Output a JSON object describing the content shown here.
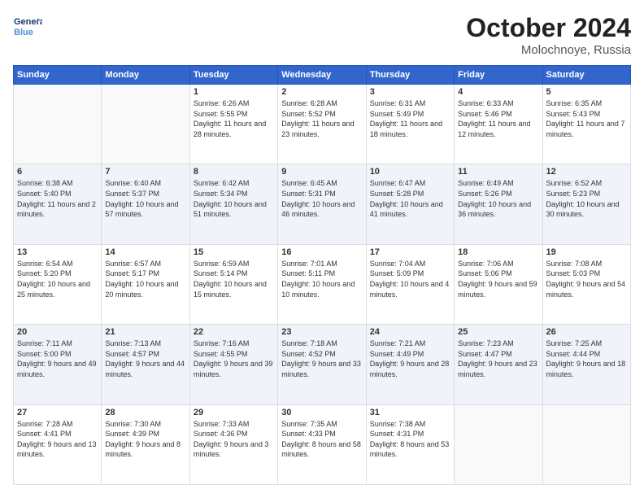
{
  "header": {
    "logo_line1": "General",
    "logo_line2": "Blue",
    "month": "October 2024",
    "location": "Molochnoye, Russia"
  },
  "weekdays": [
    "Sunday",
    "Monday",
    "Tuesday",
    "Wednesday",
    "Thursday",
    "Friday",
    "Saturday"
  ],
  "weeks": [
    [
      {
        "day": "",
        "info": ""
      },
      {
        "day": "",
        "info": ""
      },
      {
        "day": "1",
        "info": "Sunrise: 6:26 AM\nSunset: 5:55 PM\nDaylight: 11 hours and 28 minutes."
      },
      {
        "day": "2",
        "info": "Sunrise: 6:28 AM\nSunset: 5:52 PM\nDaylight: 11 hours and 23 minutes."
      },
      {
        "day": "3",
        "info": "Sunrise: 6:31 AM\nSunset: 5:49 PM\nDaylight: 11 hours and 18 minutes."
      },
      {
        "day": "4",
        "info": "Sunrise: 6:33 AM\nSunset: 5:46 PM\nDaylight: 11 hours and 12 minutes."
      },
      {
        "day": "5",
        "info": "Sunrise: 6:35 AM\nSunset: 5:43 PM\nDaylight: 11 hours and 7 minutes."
      }
    ],
    [
      {
        "day": "6",
        "info": "Sunrise: 6:38 AM\nSunset: 5:40 PM\nDaylight: 11 hours and 2 minutes."
      },
      {
        "day": "7",
        "info": "Sunrise: 6:40 AM\nSunset: 5:37 PM\nDaylight: 10 hours and 57 minutes."
      },
      {
        "day": "8",
        "info": "Sunrise: 6:42 AM\nSunset: 5:34 PM\nDaylight: 10 hours and 51 minutes."
      },
      {
        "day": "9",
        "info": "Sunrise: 6:45 AM\nSunset: 5:31 PM\nDaylight: 10 hours and 46 minutes."
      },
      {
        "day": "10",
        "info": "Sunrise: 6:47 AM\nSunset: 5:28 PM\nDaylight: 10 hours and 41 minutes."
      },
      {
        "day": "11",
        "info": "Sunrise: 6:49 AM\nSunset: 5:26 PM\nDaylight: 10 hours and 36 minutes."
      },
      {
        "day": "12",
        "info": "Sunrise: 6:52 AM\nSunset: 5:23 PM\nDaylight: 10 hours and 30 minutes."
      }
    ],
    [
      {
        "day": "13",
        "info": "Sunrise: 6:54 AM\nSunset: 5:20 PM\nDaylight: 10 hours and 25 minutes."
      },
      {
        "day": "14",
        "info": "Sunrise: 6:57 AM\nSunset: 5:17 PM\nDaylight: 10 hours and 20 minutes."
      },
      {
        "day": "15",
        "info": "Sunrise: 6:59 AM\nSunset: 5:14 PM\nDaylight: 10 hours and 15 minutes."
      },
      {
        "day": "16",
        "info": "Sunrise: 7:01 AM\nSunset: 5:11 PM\nDaylight: 10 hours and 10 minutes."
      },
      {
        "day": "17",
        "info": "Sunrise: 7:04 AM\nSunset: 5:09 PM\nDaylight: 10 hours and 4 minutes."
      },
      {
        "day": "18",
        "info": "Sunrise: 7:06 AM\nSunset: 5:06 PM\nDaylight: 9 hours and 59 minutes."
      },
      {
        "day": "19",
        "info": "Sunrise: 7:08 AM\nSunset: 5:03 PM\nDaylight: 9 hours and 54 minutes."
      }
    ],
    [
      {
        "day": "20",
        "info": "Sunrise: 7:11 AM\nSunset: 5:00 PM\nDaylight: 9 hours and 49 minutes."
      },
      {
        "day": "21",
        "info": "Sunrise: 7:13 AM\nSunset: 4:57 PM\nDaylight: 9 hours and 44 minutes."
      },
      {
        "day": "22",
        "info": "Sunrise: 7:16 AM\nSunset: 4:55 PM\nDaylight: 9 hours and 39 minutes."
      },
      {
        "day": "23",
        "info": "Sunrise: 7:18 AM\nSunset: 4:52 PM\nDaylight: 9 hours and 33 minutes."
      },
      {
        "day": "24",
        "info": "Sunrise: 7:21 AM\nSunset: 4:49 PM\nDaylight: 9 hours and 28 minutes."
      },
      {
        "day": "25",
        "info": "Sunrise: 7:23 AM\nSunset: 4:47 PM\nDaylight: 9 hours and 23 minutes."
      },
      {
        "day": "26",
        "info": "Sunrise: 7:25 AM\nSunset: 4:44 PM\nDaylight: 9 hours and 18 minutes."
      }
    ],
    [
      {
        "day": "27",
        "info": "Sunrise: 7:28 AM\nSunset: 4:41 PM\nDaylight: 9 hours and 13 minutes."
      },
      {
        "day": "28",
        "info": "Sunrise: 7:30 AM\nSunset: 4:39 PM\nDaylight: 9 hours and 8 minutes."
      },
      {
        "day": "29",
        "info": "Sunrise: 7:33 AM\nSunset: 4:36 PM\nDaylight: 9 hours and 3 minutes."
      },
      {
        "day": "30",
        "info": "Sunrise: 7:35 AM\nSunset: 4:33 PM\nDaylight: 8 hours and 58 minutes."
      },
      {
        "day": "31",
        "info": "Sunrise: 7:38 AM\nSunset: 4:31 PM\nDaylight: 8 hours and 53 minutes."
      },
      {
        "day": "",
        "info": ""
      },
      {
        "day": "",
        "info": ""
      }
    ]
  ]
}
